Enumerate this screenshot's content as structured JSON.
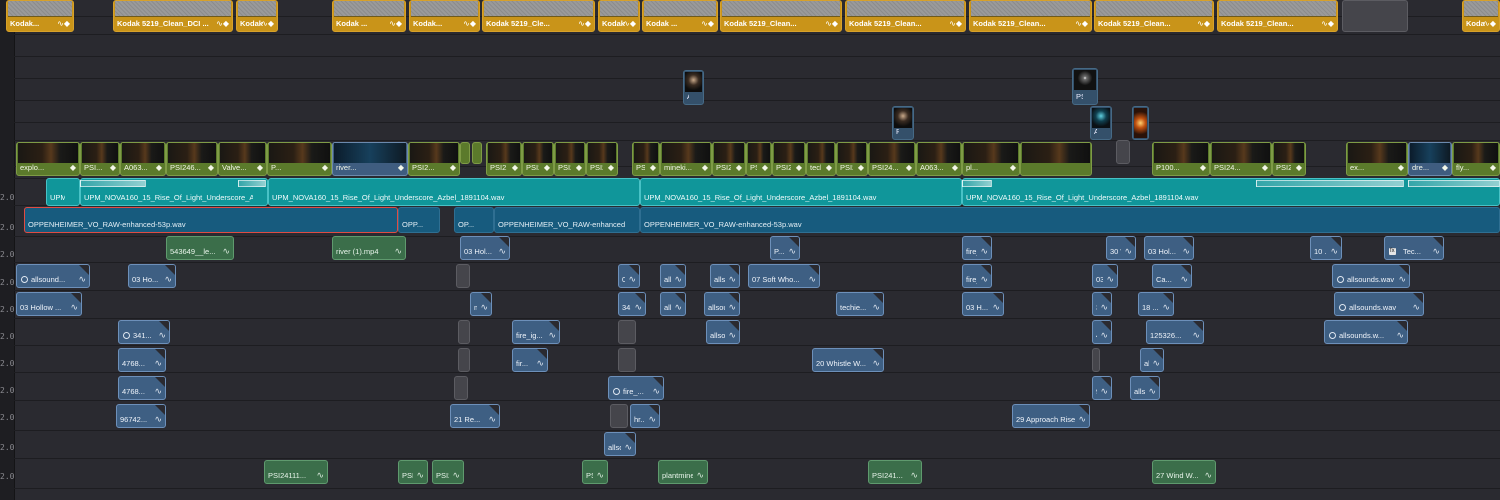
{
  "ruler": {
    "labels": [
      "2.0",
      "2.0",
      "2.0",
      "2.0",
      "2.0",
      "2.0",
      "2.0",
      "2.0",
      "2.0",
      "2.0",
      "2.0"
    ]
  },
  "video_top_row": [
    {
      "label": "Kodak..."
    },
    {
      "label": "Kodak 5219_Clean_DCI ..."
    },
    {
      "label": "Kodak ..."
    },
    {
      "label": "Kodak ..."
    },
    {
      "label": "Kodak..."
    },
    {
      "label": "Kodak 5219_Cle..."
    },
    {
      "label": "Kodak ..."
    },
    {
      "label": "Kodak ..."
    },
    {
      "label": "Kodak 5219_Clean..."
    },
    {
      "label": "Kodak 5219_Clean..."
    },
    {
      "label": "Kodak 5219_Clean..."
    },
    {
      "label": "Kodak 5219_Clean..."
    },
    {
      "label": "Kodak 5219_Clean..."
    },
    {
      "label": "Kodak 5219_Clean..."
    }
  ],
  "stills": [
    {
      "label": "A0..."
    },
    {
      "label": "PSI2..."
    },
    {
      "label": "PSI..."
    },
    {
      "label": "A0..."
    }
  ],
  "video_main": [
    {
      "label": "explo..."
    },
    {
      "label": "PSI..."
    },
    {
      "label": "A063..."
    },
    {
      "label": "PSI246..."
    },
    {
      "label": "Valve..."
    },
    {
      "label": "P..."
    },
    {
      "label": "river..."
    },
    {
      "label": "PSI2..."
    },
    {
      "label": "PSI2..."
    },
    {
      "label": "PSI24..."
    },
    {
      "label": "PSI24..."
    },
    {
      "label": "PSI24..."
    },
    {
      "label": "PSI2..."
    },
    {
      "label": "mineki..."
    },
    {
      "label": "PSI24..."
    },
    {
      "label": "PSI24..."
    },
    {
      "label": "PSI24..."
    },
    {
      "label": "techi..."
    },
    {
      "label": "PSI24..."
    },
    {
      "label": "PSI24..."
    },
    {
      "label": "A063..."
    },
    {
      "label": "pl..."
    },
    {
      "label": "P100..."
    },
    {
      "label": "PSI24..."
    },
    {
      "label": "PSI24..."
    },
    {
      "label": "ex..."
    },
    {
      "label": "dre..."
    },
    {
      "label": "fly..."
    }
  ],
  "music": [
    {
      "label": "UPM_..."
    },
    {
      "label": "UPM_NOVA160_15_Rise_Of_Light_Underscore_Azbel_1891104.wav"
    },
    {
      "label": "UPM_NOVA160_15_Rise_Of_Light_Underscore_Azbel_1891104.wav"
    },
    {
      "label": "UPM_NOVA160_15_Rise_Of_Light_Underscore_Azbel_1891104.wav"
    },
    {
      "label": "UPM_NOVA160_15_Rise_Of_Light_Underscore_Azbel_1891104.wav"
    }
  ],
  "voice_over": [
    {
      "label": "OPPENHEIMER_VO_RAW-enhanced-53p.wav"
    },
    {
      "label": "OPP..."
    },
    {
      "label": "OP..."
    },
    {
      "label": "OPPENHEIMER_VO_RAW-enhanced..."
    },
    {
      "label": "OPPENHEIMER_VO_RAW-enhanced-53p.wav"
    }
  ],
  "audio_clips": [
    {
      "label": "543649__le...",
      "kind": "foley"
    },
    {
      "label": "river (1).mp4",
      "kind": "foley"
    },
    {
      "label": "03 Hol...",
      "kind": "sfx"
    },
    {
      "label": "P...",
      "kind": "sfx"
    },
    {
      "label": "fire_...",
      "kind": "sfx"
    },
    {
      "label": "30 Wi...",
      "kind": "sfx"
    },
    {
      "label": "03 Hol...",
      "kind": "sfx"
    },
    {
      "label": "10 ...",
      "kind": "sfx"
    },
    {
      "label": "Tec...",
      "kind": "sfx",
      "icon": "fx"
    },
    {
      "label": "allsound...",
      "kind": "sfx",
      "icon": "gauge"
    },
    {
      "label": "03 Ho...",
      "kind": "sfx"
    },
    {
      "label": "03 ...",
      "kind": "sfx"
    },
    {
      "label": "alls...",
      "kind": "sfx"
    },
    {
      "label": "alls...",
      "kind": "sfx"
    },
    {
      "label": "07 Soft Who...",
      "kind": "sfx"
    },
    {
      "label": "fire_i...",
      "kind": "sfx"
    },
    {
      "label": "03 ...",
      "kind": "sfx"
    },
    {
      "label": "Ca...",
      "kind": "sfx"
    },
    {
      "label": "allsounds.wav",
      "kind": "sfx",
      "icon": "gauge"
    },
    {
      "label": "03 Hollow ...",
      "kind": "sfx"
    },
    {
      "label": "mi...",
      "kind": "sfx"
    },
    {
      "label": "341...",
      "kind": "sfx"
    },
    {
      "label": "alls...",
      "kind": "sfx"
    },
    {
      "label": "allsou...",
      "kind": "sfx"
    },
    {
      "label": "techie...",
      "kind": "sfx"
    },
    {
      "label": "03 H...",
      "kind": "sfx"
    },
    {
      "label": "34...",
      "kind": "sfx"
    },
    {
      "label": "18 ...",
      "kind": "sfx"
    },
    {
      "label": "allsounds.wav",
      "kind": "sfx",
      "icon": "gauge"
    },
    {
      "label": "341...",
      "kind": "sfx",
      "icon": "gauge"
    },
    {
      "label": "fire_ig...",
      "kind": "sfx"
    },
    {
      "label": "allsou...",
      "kind": "sfx"
    },
    {
      "label": "47...",
      "kind": "sfx"
    },
    {
      "label": "125326...",
      "kind": "sfx"
    },
    {
      "label": "allsounds.w...",
      "kind": "sfx",
      "icon": "gauge"
    },
    {
      "label": "4768...",
      "kind": "sfx"
    },
    {
      "label": "fir...",
      "kind": "sfx"
    },
    {
      "label": "20 Whistle W...",
      "kind": "sfx"
    },
    {
      "label": "alls...",
      "kind": "sfx"
    },
    {
      "label": "4768...",
      "kind": "sfx"
    },
    {
      "label": "fire_...",
      "kind": "sfx",
      "icon": "gauge"
    },
    {
      "label": "96...",
      "kind": "sfx"
    },
    {
      "label": "alls...",
      "kind": "sfx"
    },
    {
      "label": "96742...",
      "kind": "sfx"
    },
    {
      "label": "21 Re...",
      "kind": "sfx"
    },
    {
      "label": "hr...",
      "kind": "sfx"
    },
    {
      "label": "29 Approach Riser...",
      "kind": "sfx"
    },
    {
      "label": "allsou...",
      "kind": "sfx"
    },
    {
      "label": "PSI24111...",
      "kind": "foley"
    },
    {
      "label": "PSI2...",
      "kind": "foley"
    },
    {
      "label": "PSI24...",
      "kind": "foley"
    },
    {
      "label": "PSI2...",
      "kind": "foley"
    },
    {
      "label": "plantmines...",
      "kind": "foley"
    },
    {
      "label": "PSI241...",
      "kind": "foley"
    },
    {
      "label": "27 Wind W...",
      "kind": "foley"
    }
  ]
}
